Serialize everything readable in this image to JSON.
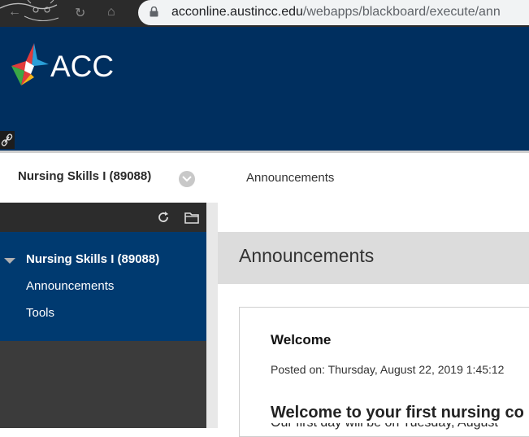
{
  "browser": {
    "url_host": "acconline.austincc.edu",
    "url_path": "/webapps/blackboard/execute/ann"
  },
  "header": {
    "logo_text": "ACC"
  },
  "course_bar": {
    "course_title": "Nursing Skills I (89088)",
    "breadcrumb": "Announcements"
  },
  "course_menu": {
    "course_title": "Nursing Skills I (89088)",
    "items": [
      {
        "label": "Announcements"
      },
      {
        "label": "Tools"
      }
    ]
  },
  "main": {
    "page_title": "Announcements",
    "announcement": {
      "title": "Welcome",
      "posted_on": "Posted on: Thursday, August 22, 2019 1:45:12",
      "heading": "Welcome to your first nursing co",
      "snippet": "Our first day will be on Tuesday, August"
    }
  },
  "colors": {
    "header_blue": "#002f5f",
    "menu_blue": "#003a70",
    "panel_dark": "#3b3b3b"
  },
  "icons": [
    "back-arrow-icon",
    "forward-arrow-icon",
    "reload-icon",
    "home-icon",
    "lock-icon",
    "link-icon",
    "chevron-down-icon",
    "refresh-icon",
    "folder-icon",
    "collapse-triangle-icon"
  ]
}
